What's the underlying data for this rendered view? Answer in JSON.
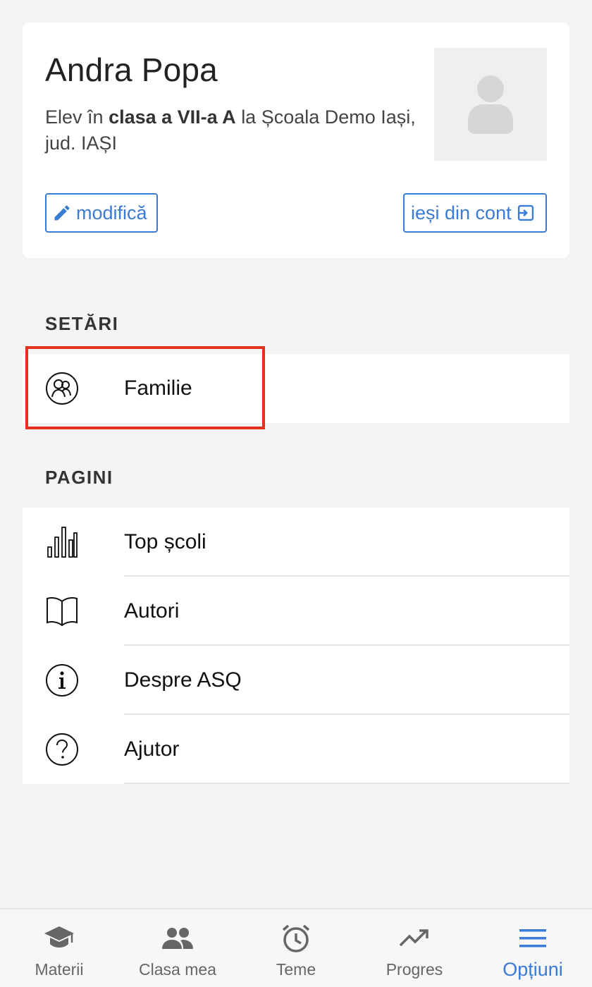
{
  "profile": {
    "name": "Andra Popa",
    "desc_prefix": "Elev în",
    "desc_class": "clasa a VII-a A",
    "desc_suffix": "la Școala Demo Iași, jud. IAȘI",
    "edit_label": "modifică",
    "logout_label": "ieși din cont"
  },
  "settings": {
    "title": "SETĂRI",
    "items": [
      {
        "label": "Familie",
        "icon": "family-icon"
      }
    ]
  },
  "pages": {
    "title": "PAGINI",
    "items": [
      {
        "label": "Top școli",
        "icon": "bar-chart-icon"
      },
      {
        "label": "Autori",
        "icon": "book-icon"
      },
      {
        "label": "Despre ASQ",
        "icon": "info-icon"
      },
      {
        "label": "Ajutor",
        "icon": "help-icon"
      }
    ]
  },
  "tabbar": {
    "tabs": [
      {
        "label": "Materii",
        "icon": "graduation-cap-icon"
      },
      {
        "label": "Clasa mea",
        "icon": "people-icon"
      },
      {
        "label": "Teme",
        "icon": "alarm-clock-icon"
      },
      {
        "label": "Progres",
        "icon": "trending-up-icon"
      },
      {
        "label": "Opțiuni",
        "icon": "menu-icon"
      }
    ],
    "active_index": 4
  },
  "colors": {
    "accent": "#3a7bd5",
    "highlight": "#e2311d",
    "inactive": "#666666"
  }
}
